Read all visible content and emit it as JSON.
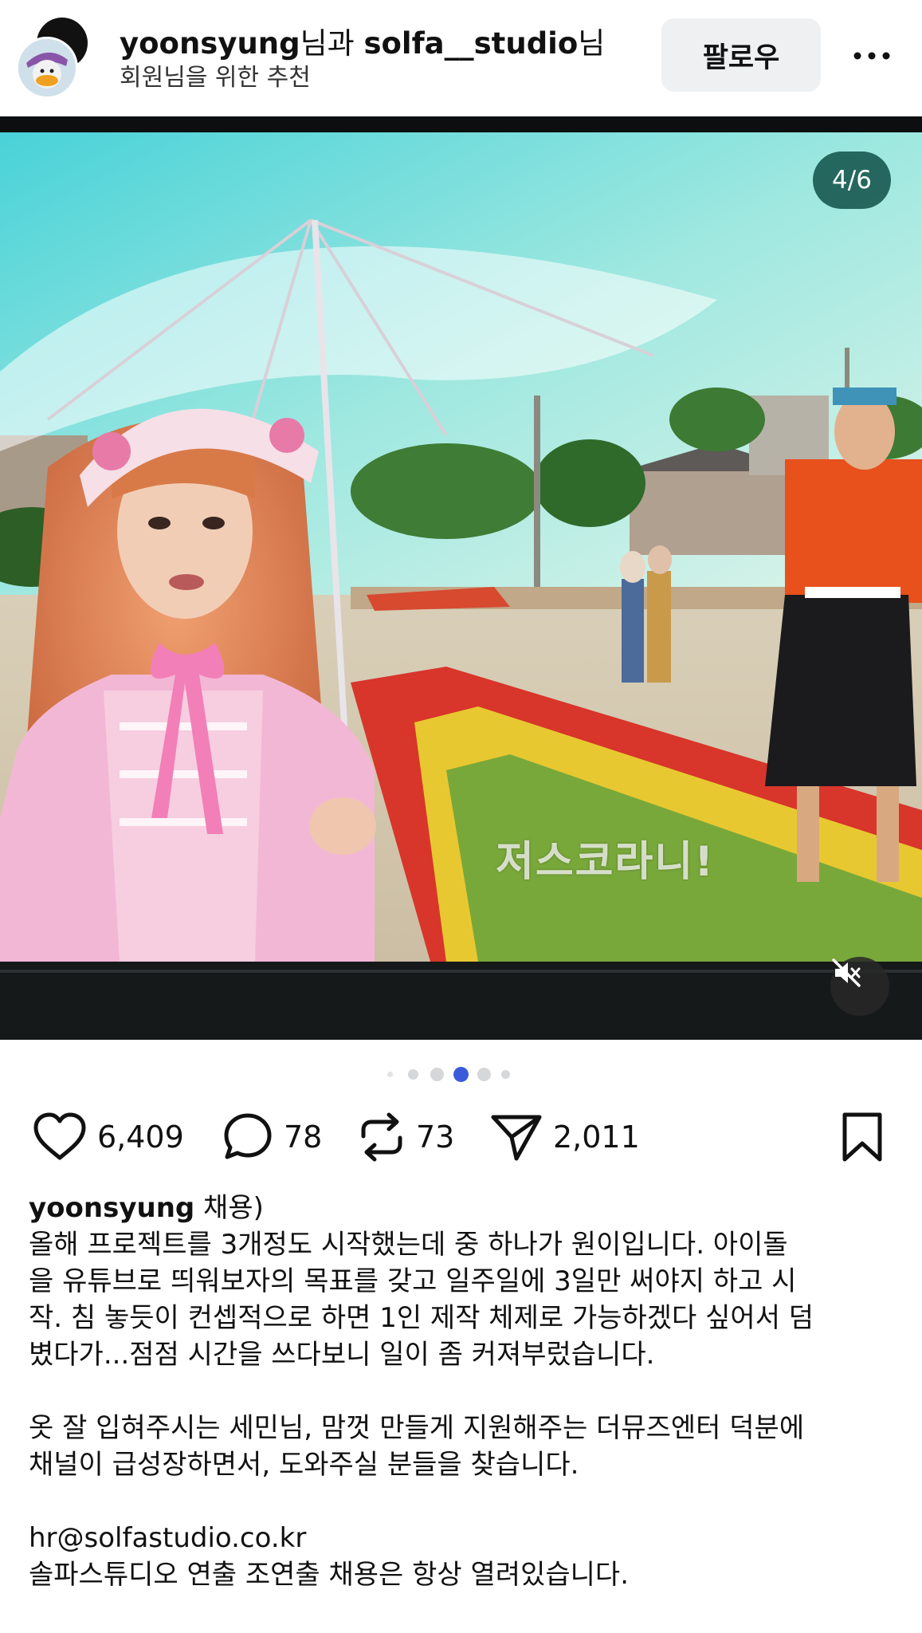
{
  "header": {
    "username_1": "yoonsyung",
    "connector": "님과 ",
    "username_2": "solfa__studio",
    "suffix": "님",
    "subtitle": "회원님을 위한 추천",
    "follow_label": "팔로우",
    "more_icon": "more-horizontal-icon"
  },
  "media": {
    "counter": "4/6",
    "subtitle_text": "저스코라니!",
    "mute_icon": "muted-speaker-icon"
  },
  "carousel": {
    "total_dots": 6,
    "active_index": 3
  },
  "actions": {
    "likes": "6,409",
    "comments": "78",
    "reposts": "73",
    "shares": "2,011"
  },
  "caption": {
    "username": "yoonsyung",
    "title": " 채용)",
    "line1": "올해 프로젝트를 3개정도 시작했는데 중 하나가 원이입니다. 아이돌",
    "line2": "을 유튜브로 띄워보자의 목표를 갖고 일주일에 3일만 써야지 하고 시",
    "line3": "작. 침 놓듯이 컨셉적으로 하면 1인 제작 체제로 가능하겠다 싶어서 덤",
    "line4": "볐다가...점점 시간을 쓰다보니 일이 좀 커져부렀습니다.",
    "line5": "옷 잘 입혀주시는 세민님, 맘껏 만들게 지원해주는 더뮤즈엔터 덕분에",
    "line6": "채널이 급성장하면서, 도와주실 분들을 찾습니다.",
    "email": "hr@solfastudio.co.kr",
    "line7": "솔파스튜디오 연출 조연출 채용은 항상 열려있습니다."
  },
  "colors": {
    "accent_dot": "#3b5bdb",
    "counter_bg": "#0f5046",
    "follow_bg": "#eef0f2"
  }
}
